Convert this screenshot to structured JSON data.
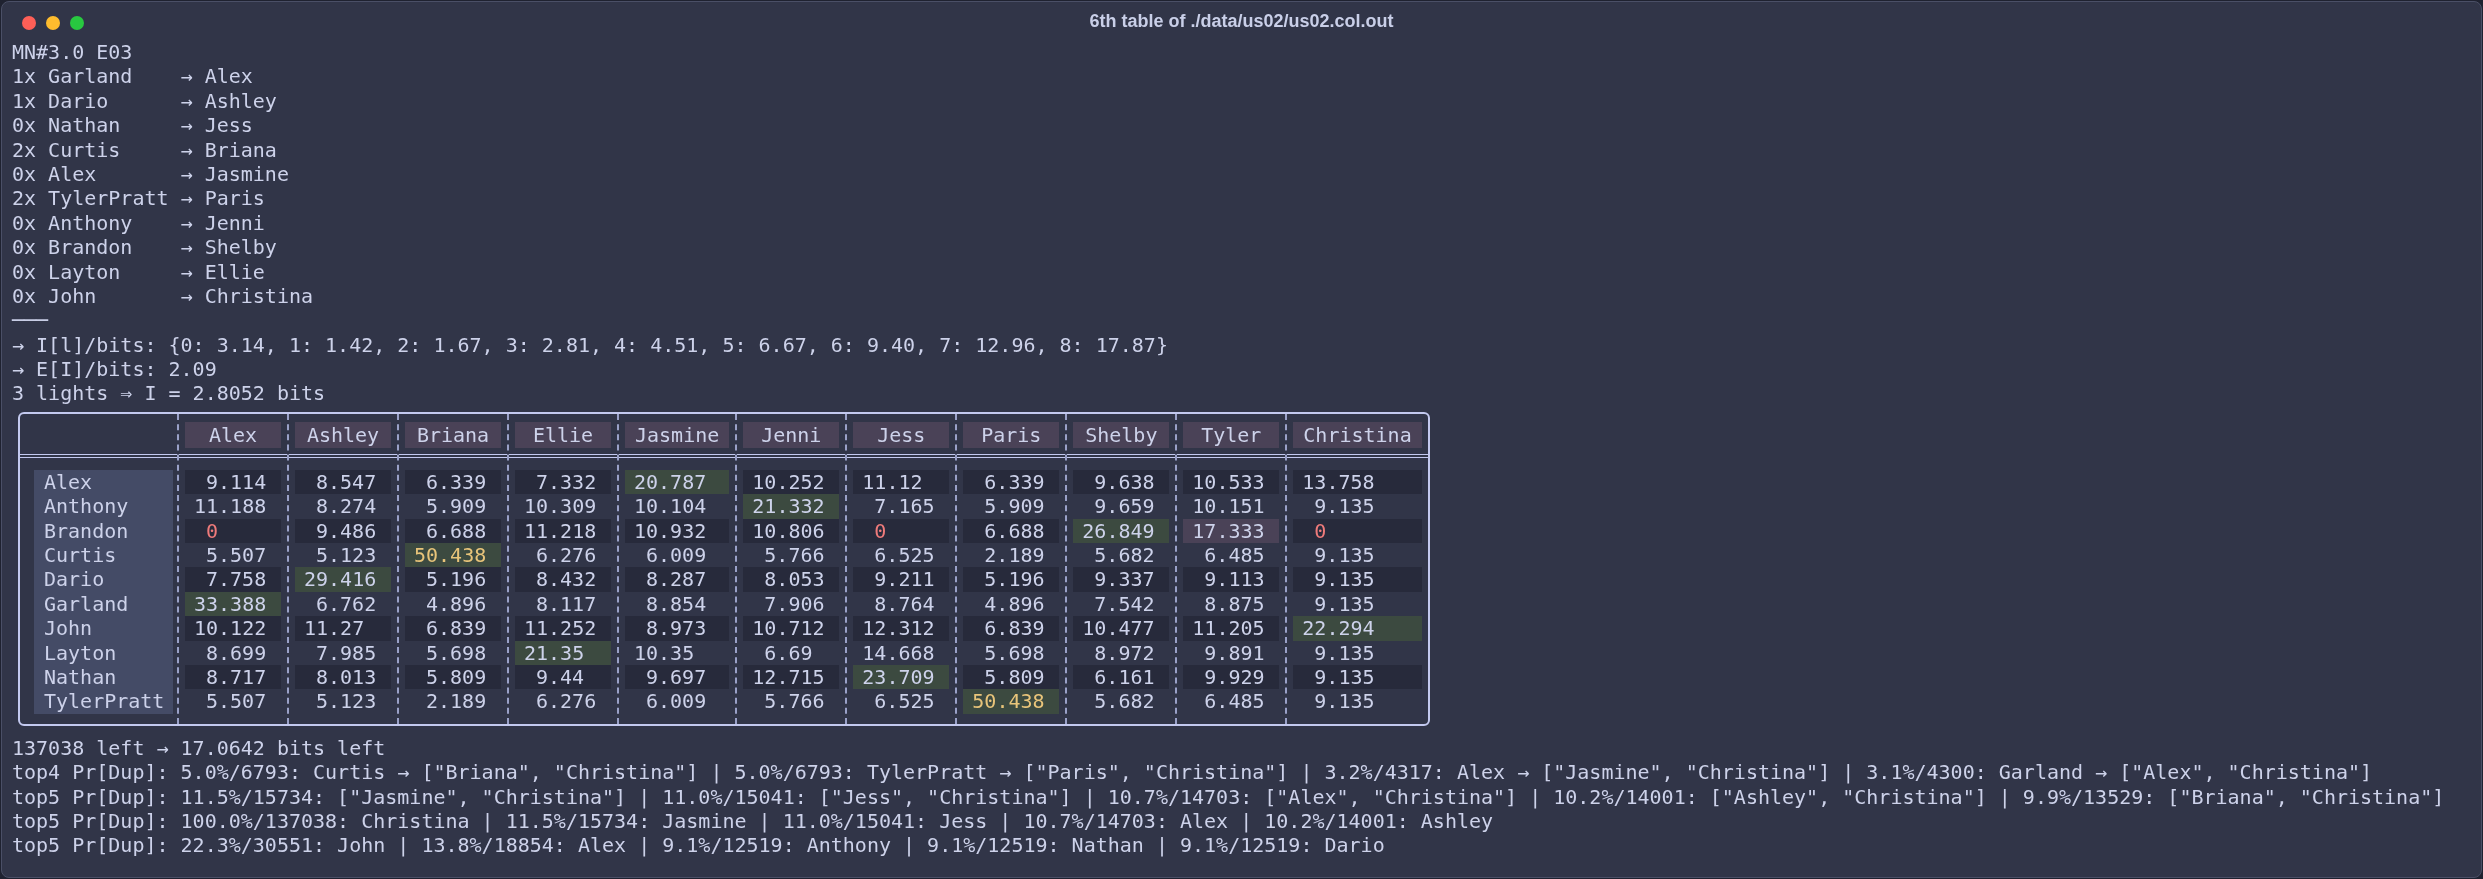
{
  "window": {
    "title": "6th table of ./data/us02/us02.col.out"
  },
  "output_lines": [
    "MN#3.0 E03",
    "1x Garland    → Alex",
    "1x Dario      → Ashley",
    "0x Nathan     → Jess",
    "2x Curtis     → Briana",
    "0x Alex       → Jasmine",
    "2x TylerPratt → Paris",
    "0x Anthony    → Jenni",
    "0x Brandon    → Shelby",
    "0x Layton     → Ellie",
    "0x John       → Christina",
    "───",
    "→ I[l]/bits: {0: 3.14, 1: 1.42, 2: 1.67, 3: 2.81, 4: 4.51, 5: 6.67, 6: 9.40, 7: 12.96, 8: 17.87}",
    "→ E[I]/bits: 2.09",
    "3 lights ⇒ I = 2.8052 bits"
  ],
  "table": {
    "columns": [
      "Alex",
      "Ashley",
      "Briana",
      "Ellie",
      "Jasmine",
      "Jenni",
      "Jess",
      "Paris",
      "Shelby",
      "Tyler",
      "Christina"
    ],
    "rows": [
      {
        "name": "Alex",
        "cells": [
          {
            "text": "9.114",
            "kind": "plain"
          },
          {
            "text": "8.547",
            "kind": "plain"
          },
          {
            "text": "6.339",
            "kind": "plain"
          },
          {
            "text": "7.332",
            "kind": "plain"
          },
          {
            "text": "20.787",
            "kind": "match"
          },
          {
            "text": "10.252",
            "kind": "plain"
          },
          {
            "text": "11.12",
            "kind": "plain"
          },
          {
            "text": "6.339",
            "kind": "plain"
          },
          {
            "text": "9.638",
            "kind": "plain"
          },
          {
            "text": "10.533",
            "kind": "plain"
          },
          {
            "text": "13.758",
            "kind": "plain"
          }
        ]
      },
      {
        "name": "Anthony",
        "cells": [
          {
            "text": "11.188",
            "kind": "plain"
          },
          {
            "text": "8.274",
            "kind": "plain"
          },
          {
            "text": "5.909",
            "kind": "plain"
          },
          {
            "text": "10.309",
            "kind": "plain"
          },
          {
            "text": "10.104",
            "kind": "plain"
          },
          {
            "text": "21.332",
            "kind": "match"
          },
          {
            "text": "7.165",
            "kind": "plain"
          },
          {
            "text": "5.909",
            "kind": "plain"
          },
          {
            "text": "9.659",
            "kind": "plain"
          },
          {
            "text": "10.151",
            "kind": "plain"
          },
          {
            "text": "9.135",
            "kind": "plain"
          }
        ]
      },
      {
        "name": "Brandon",
        "cells": [
          {
            "text": "0",
            "kind": "zero"
          },
          {
            "text": "9.486",
            "kind": "plain"
          },
          {
            "text": "6.688",
            "kind": "plain"
          },
          {
            "text": "11.218",
            "kind": "plain"
          },
          {
            "text": "10.932",
            "kind": "plain"
          },
          {
            "text": "10.806",
            "kind": "plain"
          },
          {
            "text": "0",
            "kind": "zero"
          },
          {
            "text": "6.688",
            "kind": "plain"
          },
          {
            "text": "26.849",
            "kind": "match"
          },
          {
            "text": "17.333",
            "kind": "alt"
          },
          {
            "text": "0",
            "kind": "zero"
          }
        ]
      },
      {
        "name": "Curtis",
        "cells": [
          {
            "text": "5.507",
            "kind": "plain"
          },
          {
            "text": "5.123",
            "kind": "plain"
          },
          {
            "text": "50.438",
            "kind": "strong"
          },
          {
            "text": "6.276",
            "kind": "plain"
          },
          {
            "text": "6.009",
            "kind": "plain"
          },
          {
            "text": "5.766",
            "kind": "plain"
          },
          {
            "text": "6.525",
            "kind": "plain"
          },
          {
            "text": "2.189",
            "kind": "plain"
          },
          {
            "text": "5.682",
            "kind": "plain"
          },
          {
            "text": "6.485",
            "kind": "plain"
          },
          {
            "text": "9.135",
            "kind": "plain"
          }
        ]
      },
      {
        "name": "Dario",
        "cells": [
          {
            "text": "7.758",
            "kind": "plain"
          },
          {
            "text": "29.416",
            "kind": "match"
          },
          {
            "text": "5.196",
            "kind": "plain"
          },
          {
            "text": "8.432",
            "kind": "plain"
          },
          {
            "text": "8.287",
            "kind": "plain"
          },
          {
            "text": "8.053",
            "kind": "plain"
          },
          {
            "text": "9.211",
            "kind": "plain"
          },
          {
            "text": "5.196",
            "kind": "plain"
          },
          {
            "text": "9.337",
            "kind": "plain"
          },
          {
            "text": "9.113",
            "kind": "plain"
          },
          {
            "text": "9.135",
            "kind": "plain"
          }
        ]
      },
      {
        "name": "Garland",
        "cells": [
          {
            "text": "33.388",
            "kind": "match"
          },
          {
            "text": "6.762",
            "kind": "plain"
          },
          {
            "text": "4.896",
            "kind": "plain"
          },
          {
            "text": "8.117",
            "kind": "plain"
          },
          {
            "text": "8.854",
            "kind": "plain"
          },
          {
            "text": "7.906",
            "kind": "plain"
          },
          {
            "text": "8.764",
            "kind": "plain"
          },
          {
            "text": "4.896",
            "kind": "plain"
          },
          {
            "text": "7.542",
            "kind": "plain"
          },
          {
            "text": "8.875",
            "kind": "plain"
          },
          {
            "text": "9.135",
            "kind": "plain"
          }
        ]
      },
      {
        "name": "John",
        "cells": [
          {
            "text": "10.122",
            "kind": "plain"
          },
          {
            "text": "11.27",
            "kind": "plain"
          },
          {
            "text": "6.839",
            "kind": "plain"
          },
          {
            "text": "11.252",
            "kind": "plain"
          },
          {
            "text": "8.973",
            "kind": "plain"
          },
          {
            "text": "10.712",
            "kind": "plain"
          },
          {
            "text": "12.312",
            "kind": "plain"
          },
          {
            "text": "6.839",
            "kind": "plain"
          },
          {
            "text": "10.477",
            "kind": "plain"
          },
          {
            "text": "11.205",
            "kind": "plain"
          },
          {
            "text": "22.294",
            "kind": "match"
          }
        ]
      },
      {
        "name": "Layton",
        "cells": [
          {
            "text": "8.699",
            "kind": "plain"
          },
          {
            "text": "7.985",
            "kind": "plain"
          },
          {
            "text": "5.698",
            "kind": "plain"
          },
          {
            "text": "21.35",
            "kind": "match"
          },
          {
            "text": "10.35",
            "kind": "plain"
          },
          {
            "text": "6.69",
            "kind": "plain"
          },
          {
            "text": "14.668",
            "kind": "plain"
          },
          {
            "text": "5.698",
            "kind": "plain"
          },
          {
            "text": "8.972",
            "kind": "plain"
          },
          {
            "text": "9.891",
            "kind": "plain"
          },
          {
            "text": "9.135",
            "kind": "plain"
          }
        ]
      },
      {
        "name": "Nathan",
        "cells": [
          {
            "text": "8.717",
            "kind": "plain"
          },
          {
            "text": "8.013",
            "kind": "plain"
          },
          {
            "text": "5.809",
            "kind": "plain"
          },
          {
            "text": "9.44",
            "kind": "plain"
          },
          {
            "text": "9.697",
            "kind": "plain"
          },
          {
            "text": "12.715",
            "kind": "plain"
          },
          {
            "text": "23.709",
            "kind": "match"
          },
          {
            "text": "5.809",
            "kind": "plain"
          },
          {
            "text": "6.161",
            "kind": "plain"
          },
          {
            "text": "9.929",
            "kind": "plain"
          },
          {
            "text": "9.135",
            "kind": "plain"
          }
        ]
      },
      {
        "name": "TylerPratt",
        "cells": [
          {
            "text": "5.507",
            "kind": "plain"
          },
          {
            "text": "5.123",
            "kind": "plain"
          },
          {
            "text": "2.189",
            "kind": "plain"
          },
          {
            "text": "6.276",
            "kind": "plain"
          },
          {
            "text": "6.009",
            "kind": "plain"
          },
          {
            "text": "5.766",
            "kind": "plain"
          },
          {
            "text": "6.525",
            "kind": "plain"
          },
          {
            "text": "50.438",
            "kind": "strong"
          },
          {
            "text": "5.682",
            "kind": "plain"
          },
          {
            "text": "6.485",
            "kind": "plain"
          },
          {
            "text": "9.135",
            "kind": "plain"
          }
        ]
      }
    ]
  },
  "summary_lines": [
    "137038 left → 17.0642 bits left",
    "top4 Pr[Dup]: 5.0%/6793: Curtis → [\"Briana\", \"Christina\"] | 5.0%/6793: TylerPratt → [\"Paris\", \"Christina\"] | 3.2%/4317: Alex → [\"Jasmine\", \"Christina\"] | 3.1%/4300: Garland → [\"Alex\", \"Christina\"]",
    "top5 Pr[Dup]: 11.5%/15734: [\"Jasmine\", \"Christina\"] | 11.0%/15041: [\"Jess\", \"Christina\"] | 10.7%/14703: [\"Alex\", \"Christina\"] | 10.2%/14001: [\"Ashley\", \"Christina\"] | 9.9%/13529: [\"Briana\", \"Christina\"]",
    "top5 Pr[Dup]: 100.0%/137038: Christina | 11.5%/15734: Jasmine | 11.0%/15041: Jess | 10.7%/14703: Alex | 10.2%/14001: Ashley",
    "top5 Pr[Dup]: 22.3%/30551: John | 13.8%/18854: Alex | 9.1%/12519: Anthony | 9.1%/12519: Nathan | 9.1%/12519: Dario"
  ]
}
